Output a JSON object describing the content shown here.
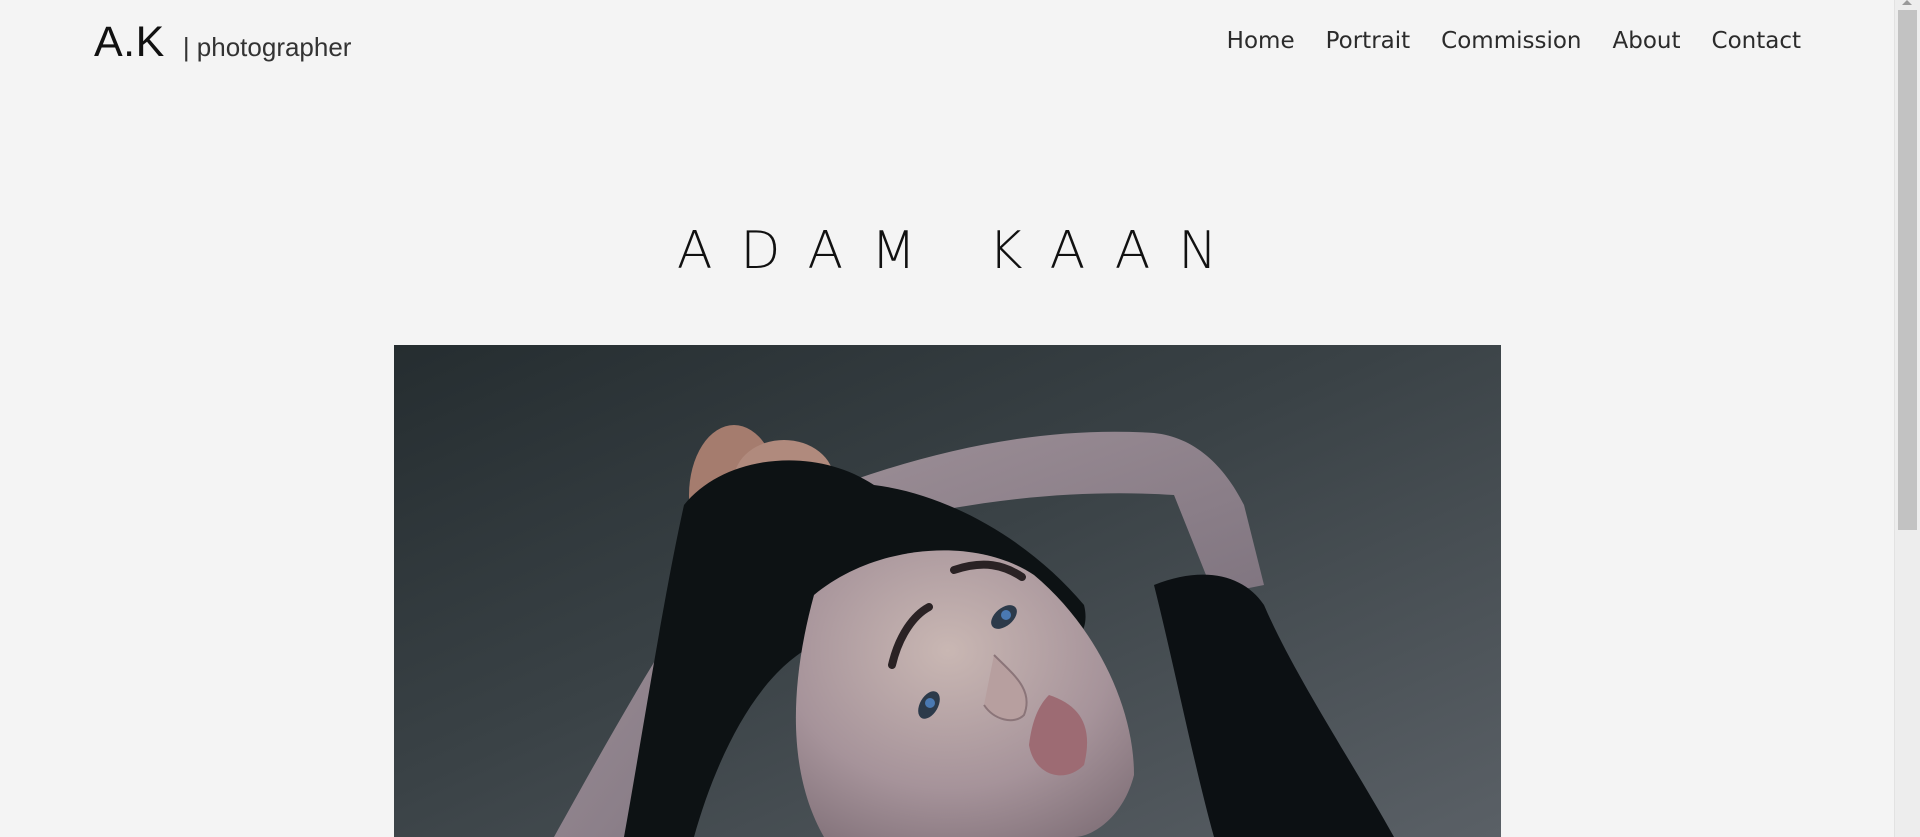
{
  "header": {
    "logo": "A.K",
    "tagline": "| photographer"
  },
  "nav": {
    "items": [
      {
        "label": "Home"
      },
      {
        "label": "Portrait"
      },
      {
        "label": "Commission"
      },
      {
        "label": "About"
      },
      {
        "label": "Contact"
      }
    ]
  },
  "hero": {
    "title": "ADAM KAAN"
  },
  "colors": {
    "background": "#f4f4f4",
    "text": "#1a1a1a"
  }
}
